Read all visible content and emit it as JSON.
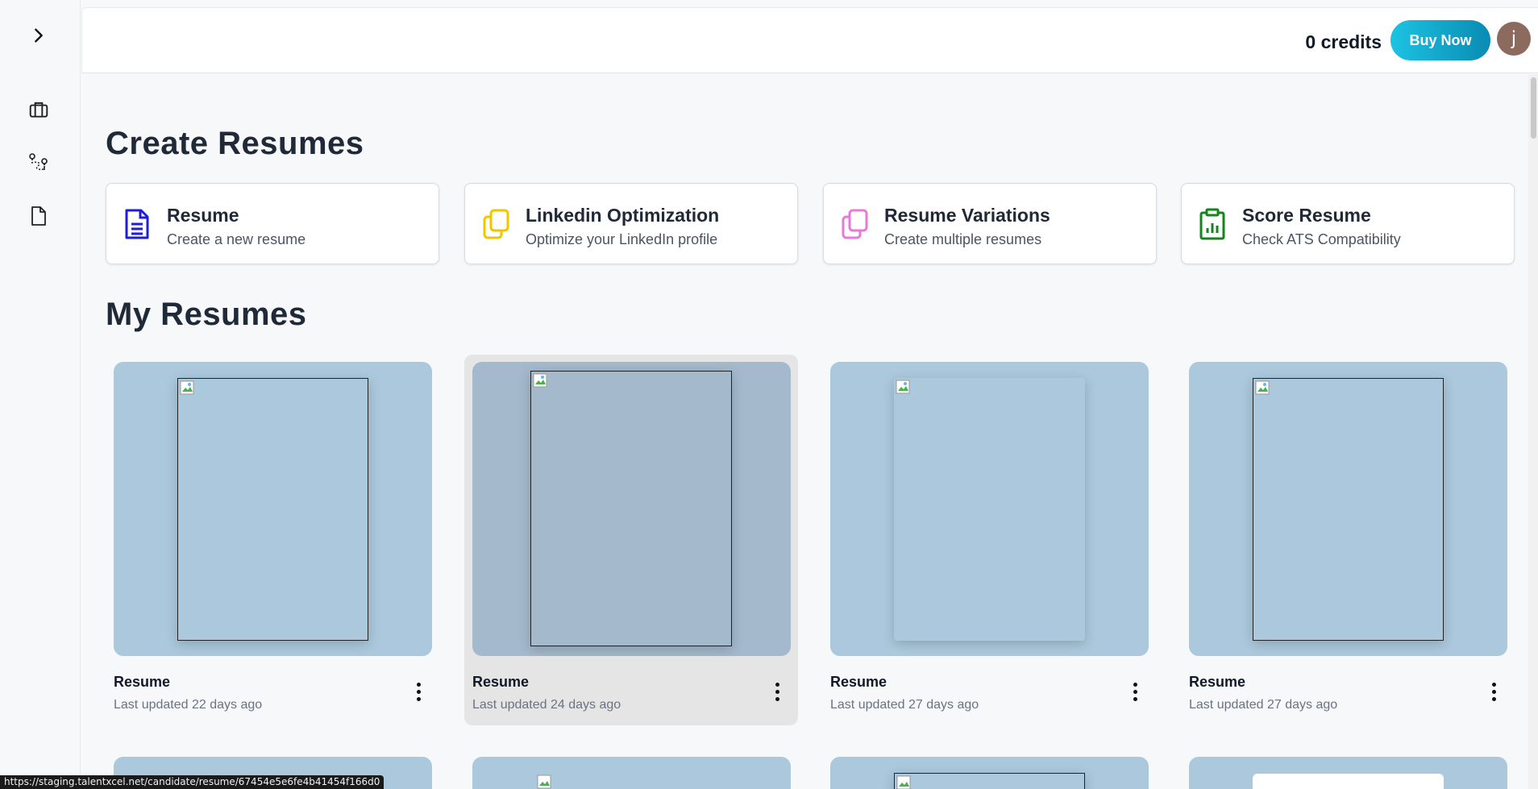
{
  "sidebar": {
    "toggle_icon": "chevron-right-icon",
    "items": [
      {
        "icon": "briefcase-icon"
      },
      {
        "icon": "route-icon"
      },
      {
        "icon": "document-icon"
      }
    ]
  },
  "header": {
    "credits": "0 credits",
    "buy_label": "Buy Now",
    "avatar_initial": "j",
    "accent_gradient": [
      "#1cc3e2",
      "#0a8bb3"
    ],
    "avatar_color": "#8d6a5e"
  },
  "create": {
    "heading": "Create Resumes",
    "cards": [
      {
        "title": "Resume",
        "subtitle": "Create a new resume",
        "icon": "file-text-icon",
        "color": "#1d1ddb"
      },
      {
        "title": "Linkedin Optimization",
        "subtitle": "Optimize your LinkedIn profile",
        "icon": "copy-icon",
        "color": "#f2c500"
      },
      {
        "title": "Resume Variations",
        "subtitle": "Create multiple resumes",
        "icon": "copy-icon",
        "color": "#e879d9"
      },
      {
        "title": "Score Resume",
        "subtitle": "Check ATS Compatibility",
        "icon": "clipboard-chart-icon",
        "color": "#16841c"
      }
    ]
  },
  "my_resumes": {
    "heading": "My Resumes",
    "items": [
      {
        "title": "Resume",
        "updated": "Last updated 22 days ago"
      },
      {
        "title": "Resume",
        "updated": "Last updated 24 days ago"
      },
      {
        "title": "Resume",
        "updated": "Last updated 27 days ago"
      },
      {
        "title": "Resume",
        "updated": "Last updated 27 days ago"
      }
    ]
  },
  "status_bar": {
    "url": "https://staging.talentxcel.net/candidate/resume/67454e5e6fe4b41454f166d0"
  }
}
